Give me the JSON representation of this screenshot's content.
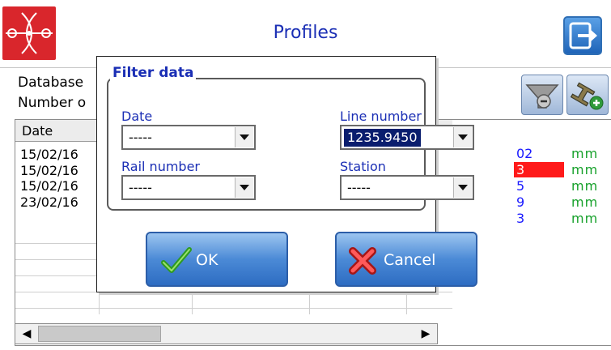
{
  "header": {
    "title": "Profiles",
    "logo_icon": "rail-profile-logo",
    "exit_icon": "exit-icon"
  },
  "background": {
    "database_label": "Database",
    "count_label": "Number o",
    "toolbar_icons": [
      "filter-icon",
      "rail-add-icon"
    ],
    "grid": {
      "header": "Date",
      "rows": [
        "15/02/16",
        "15/02/16",
        "15/02/16",
        "23/02/16"
      ],
      "right_values": [
        "02",
        "3",
        "5",
        "9",
        "3"
      ],
      "highlight_row": 1,
      "unit": "mm"
    }
  },
  "dialog": {
    "group_title": "Filter data",
    "fields": {
      "date": {
        "label": "Date",
        "value": "-----"
      },
      "line_number": {
        "label": "Line number",
        "value": "1235.9450"
      },
      "rail_number": {
        "label": "Rail number",
        "value": "-----"
      },
      "station": {
        "label": "Station",
        "value": "-----"
      }
    },
    "ok_label": "OK",
    "cancel_label": "Cancel"
  },
  "colors": {
    "title": "#1b2fb5",
    "logo": "#d9262c",
    "button": "#4b8ad6",
    "selection": "#0a1e6e",
    "unit_green": "#17a12b",
    "highlight_red": "#ff1a1a"
  }
}
